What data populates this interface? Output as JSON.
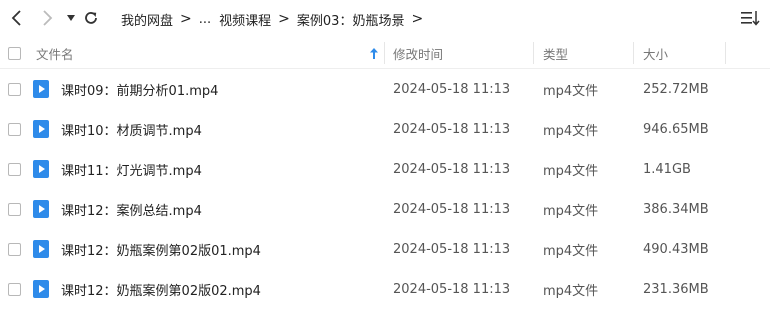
{
  "toolbar": {
    "breadcrumb": [
      "我的网盘",
      "...",
      "视频课程",
      "案例03：奶瓶场景"
    ]
  },
  "columns": {
    "name": "文件名",
    "modified": "修改时间",
    "type": "类型",
    "size": "大小"
  },
  "files": [
    {
      "name": "课时09：前期分析01.mp4",
      "modified": "2024-05-18 11:13",
      "type": "mp4文件",
      "size": "252.72MB"
    },
    {
      "name": "课时10：材质调节.mp4",
      "modified": "2024-05-18 11:13",
      "type": "mp4文件",
      "size": "946.65MB"
    },
    {
      "name": "课时11：灯光调节.mp4",
      "modified": "2024-05-18 11:13",
      "type": "mp4文件",
      "size": "1.41GB"
    },
    {
      "name": "课时12：案例总结.mp4",
      "modified": "2024-05-18 11:13",
      "type": "mp4文件",
      "size": "386.34MB"
    },
    {
      "name": "课时12：奶瓶案例第02版01.mp4",
      "modified": "2024-05-18 11:13",
      "type": "mp4文件",
      "size": "490.43MB"
    },
    {
      "name": "课时12：奶瓶案例第02版02.mp4",
      "modified": "2024-05-18 11:13",
      "type": "mp4文件",
      "size": "231.36MB"
    }
  ],
  "colors": {
    "accent": "#2e8bea",
    "sort_arrow": "#2e8bea"
  },
  "icons": [
    "back-arrow-icon",
    "forward-arrow-icon",
    "dropdown-caret-icon",
    "refresh-icon",
    "list-view-icon",
    "sort-ascending-icon",
    "video-file-icon"
  ]
}
